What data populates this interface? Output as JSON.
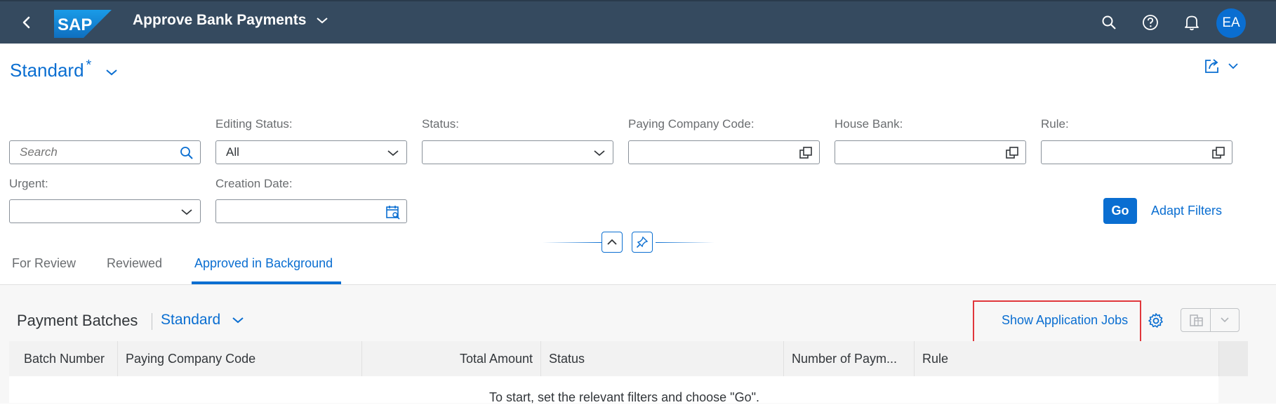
{
  "shell": {
    "logo_text": "SAP",
    "title": "Approve Bank Payments",
    "avatar_initials": "EA"
  },
  "header": {
    "variant_name": "Standard",
    "variant_modified_marker": "*"
  },
  "filters": {
    "search": {
      "placeholder": "Search",
      "value": ""
    },
    "editing_status": {
      "label": "Editing Status:",
      "value": "All"
    },
    "status": {
      "label": "Status:",
      "value": ""
    },
    "paying_company_code": {
      "label": "Paying Company Code:",
      "value": ""
    },
    "house_bank": {
      "label": "House Bank:",
      "value": ""
    },
    "rule": {
      "label": "Rule:",
      "value": ""
    },
    "urgent": {
      "label": "Urgent:",
      "value": ""
    },
    "creation_date": {
      "label": "Creation Date:",
      "value": ""
    },
    "go_label": "Go",
    "adapt_filters_label": "Adapt Filters"
  },
  "tabs": [
    {
      "label": "For Review",
      "selected": false
    },
    {
      "label": "Reviewed",
      "selected": false
    },
    {
      "label": "Approved in Background",
      "selected": true
    }
  ],
  "table": {
    "title": "Payment Batches",
    "variant": "Standard",
    "show_jobs_label": "Show Application Jobs",
    "columns": [
      "Batch Number",
      "Paying Company Code",
      "Total Amount",
      "Status",
      "Number of Paym...",
      "Rule"
    ],
    "no_data_text": "To start, set the relevant filters and choose \"Go\"."
  },
  "colors": {
    "shell_bg": "#354a5f",
    "accent": "#0a6ed1",
    "highlight_box": "#e0373c"
  }
}
